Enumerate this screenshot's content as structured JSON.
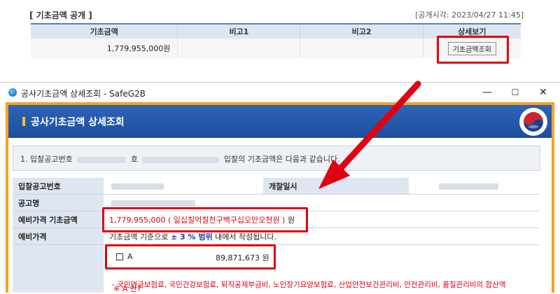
{
  "top": {
    "title": "[ 기초금액 공개 ]",
    "time": "[공개시각: 2023/04/27 11:45]",
    "columns": [
      "기초금액",
      "비고1",
      "비고2",
      "상세보기"
    ],
    "row": {
      "amount": "1,779,955,000원",
      "note1": "",
      "note2": "",
      "button": "기초금액조회"
    }
  },
  "window": {
    "title": "공사기초금액 상세조회 - SafeG2B",
    "controls": {
      "minimize": "—",
      "maximize": "☐",
      "close": "✕"
    },
    "header_title": "공사기초금액 상세조회",
    "notice": {
      "prefix": "1. 입찰공고번호",
      "middle": "호",
      "suffix": "입찰의 기초금액은 다음과 같습니다."
    },
    "labels": {
      "notice_no": "입찰공고번호",
      "open_date": "개찰일시",
      "name": "공고명",
      "base_amount": "예비가격 기초금액",
      "reserve_price": "예비가격"
    },
    "base_amount_value": "1,779,955,000 ( 일십칠억칠천구백구십오만오천원 )",
    "base_amount_unit": "원",
    "reserve": {
      "prefix": "기초금액 기준으로",
      "range": "± 3 % 범위",
      "suffix": "내에서 작성됩니다."
    },
    "choice": {
      "label": "A",
      "value": "89,871,673 원"
    },
    "note_title": "※ A 란?",
    "note_body": "- 국민연금보험료, 국민건강보험료, 퇴직공제부금비, 노인장기요양보험료, 산업안전보건관리비, 안전관리비, 품질관리비의 합산액"
  },
  "colors": {
    "accent": "#1d4f9d",
    "frame": "#f6a31c",
    "highlight": "#e00012"
  }
}
